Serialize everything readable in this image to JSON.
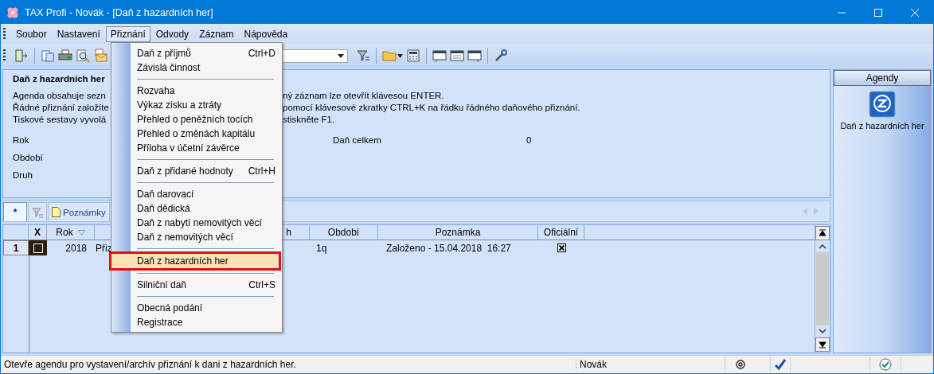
{
  "window": {
    "title": "TAX Profi - Novák - [Daň z hazardních her]"
  },
  "menu_bar": [
    {
      "label": "Soubor",
      "selected": false
    },
    {
      "label": "Nastavení",
      "selected": false
    },
    {
      "label": "Přiznání",
      "selected": true
    },
    {
      "label": "Odvody",
      "selected": false
    },
    {
      "label": "Záznam",
      "selected": false
    },
    {
      "label": "Nápověda",
      "selected": false
    }
  ],
  "dropdown_menu": {
    "items": [
      {
        "kind": "item",
        "label": "Daň z příjmů",
        "shortcut": "Ctrl+D",
        "selected": false
      },
      {
        "kind": "item",
        "label": "Závislá činnost",
        "selected": false
      },
      {
        "kind": "separator"
      },
      {
        "kind": "item",
        "label": "Rozvaha",
        "selected": false
      },
      {
        "kind": "item",
        "label": "Výkaz zisku a ztráty",
        "selected": false
      },
      {
        "kind": "item",
        "label": "Přehled o peněžních tocích",
        "selected": false
      },
      {
        "kind": "item",
        "label": "Přehled o změnách kapitálu",
        "selected": false
      },
      {
        "kind": "item",
        "label": "Příloha v účetní závěrce",
        "selected": false
      },
      {
        "kind": "separator"
      },
      {
        "kind": "item",
        "label": "Daň z přidané hodnoty",
        "shortcut": "Ctrl+H",
        "selected": false
      },
      {
        "kind": "separator"
      },
      {
        "kind": "item",
        "label": "Daň darovací",
        "selected": false
      },
      {
        "kind": "item",
        "label": "Daň dědická",
        "selected": false
      },
      {
        "kind": "item",
        "label": "Daň z nabytí nemovitých věcí",
        "selected": false
      },
      {
        "kind": "item",
        "label": "Daň z nemovitých věcí",
        "selected": false
      },
      {
        "kind": "separator"
      },
      {
        "kind": "item",
        "label": "Daň z hazardních her",
        "selected": true
      },
      {
        "kind": "separator"
      },
      {
        "kind": "item",
        "label": "Silniční daň",
        "shortcut": "Ctrl+S",
        "selected": false
      },
      {
        "kind": "separator"
      },
      {
        "kind": "item",
        "label": "Obecná podání",
        "selected": false
      },
      {
        "kind": "item",
        "label": "Registrace",
        "selected": false
      }
    ]
  },
  "info_panel": {
    "title": "Daň z hazardních her",
    "lines": [
      {
        "left": "Agenda obsahuje sezn",
        "right": "ný záznam lze otevřít klávesou ENTER."
      },
      {
        "left": "Řádné přiznání založíte",
        "right": "pomocí klávesové zkratky CTRL+K na řádku řádného daňového přiznání."
      },
      {
        "left": "Tiskové sestavy vyvolá",
        "right": "stiskněte F1."
      }
    ],
    "fields": [
      {
        "label": "Rok"
      },
      {
        "label": "Období"
      },
      {
        "label": "Druh"
      }
    ],
    "total": {
      "label": "Daň celkem",
      "value": "0"
    }
  },
  "tabs": [
    {
      "kind": "new",
      "label": "*",
      "selected": true
    },
    {
      "kind": "filter",
      "selected": false
    },
    {
      "kind": "notes",
      "label": "Poznámky",
      "selected": false
    }
  ],
  "table": {
    "columns": [
      {
        "label": "X"
      },
      {
        "label": "Rok",
        "sortable": true
      },
      {},
      {
        "label": "h"
      },
      {
        "label": "Období"
      },
      {
        "label": "Poznámka"
      },
      {
        "label": "Oficiální"
      }
    ],
    "rows": [
      {
        "number": "1",
        "marked": false,
        "year": "2018",
        "type": "Přiz",
        "period": "1q",
        "note": "Založeno - 15.04.2018  16:27",
        "official": true
      }
    ]
  },
  "agendas": {
    "title": "Agendy",
    "items": [
      {
        "label": "Daň z hazardních her"
      }
    ]
  },
  "status_bar": {
    "message": "Otevře agendu pro vystavení/archív přiznání k dani z hazardních her.",
    "user": "Novák"
  }
}
